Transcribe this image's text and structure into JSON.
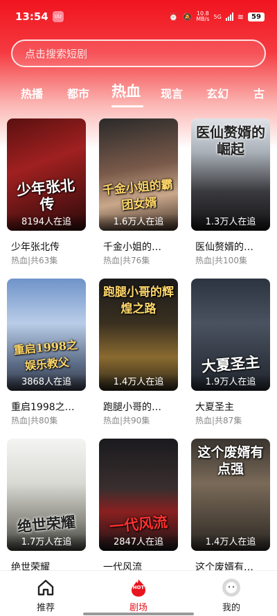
{
  "status_bar": {
    "time": "13:54",
    "app_badge": "UU",
    "speed_value": "10.8",
    "speed_unit": "MB/s",
    "network": "5G",
    "battery": "59"
  },
  "search": {
    "placeholder": "点击搜索短剧"
  },
  "tabs": [
    {
      "label": "热播"
    },
    {
      "label": "都市"
    },
    {
      "label": "热血",
      "active": true
    },
    {
      "label": "现言"
    },
    {
      "label": "玄幻"
    },
    {
      "label": "古"
    }
  ],
  "dramas": [
    {
      "title": "少年张北传",
      "poster_text": "少年张北传",
      "viewers": "8194人在追",
      "meta": "热血|共63集"
    },
    {
      "title": "千金小姐的…",
      "poster_text": "千金小姐的霸团女婿",
      "viewers": "1.6万人在追",
      "meta": "热血|共76集"
    },
    {
      "title": "医仙赘婿的…",
      "poster_text": "医仙赘婿的崛起",
      "viewers": "1.3万人在追",
      "meta": "热血|共100集"
    },
    {
      "title": "重启1998之…",
      "poster_text": "重启1998之娱乐教父",
      "viewers": "3868人在追",
      "meta": "热血|共80集"
    },
    {
      "title": "跑腿小哥的…",
      "poster_text": "跑腿小哥的辉煌之路",
      "viewers": "1.4万人在追",
      "meta": "热血|共90集"
    },
    {
      "title": "大夏圣主",
      "poster_text": "大夏圣主",
      "viewers": "1.9万人在追",
      "meta": "热血|共87集"
    },
    {
      "title": "绝世荣耀",
      "poster_text": "绝世荣耀",
      "viewers": "1.7万人在追",
      "meta": ""
    },
    {
      "title": "一代风流",
      "poster_text": "一代风流",
      "viewers": "2847人在追",
      "meta": ""
    },
    {
      "title": "这个废婿有…",
      "poster_text": "这个废婿有点强",
      "viewers": "1.4万人在追",
      "meta": ""
    }
  ],
  "bottom_nav": [
    {
      "label": "推荐",
      "icon": "home-icon"
    },
    {
      "label": "剧场",
      "icon": "hot-icon",
      "badge": "HOT",
      "active": true
    },
    {
      "label": "我的",
      "icon": "profile-icon"
    }
  ],
  "colors": {
    "accent": "#e8141e",
    "header_red": "#f0141e"
  }
}
